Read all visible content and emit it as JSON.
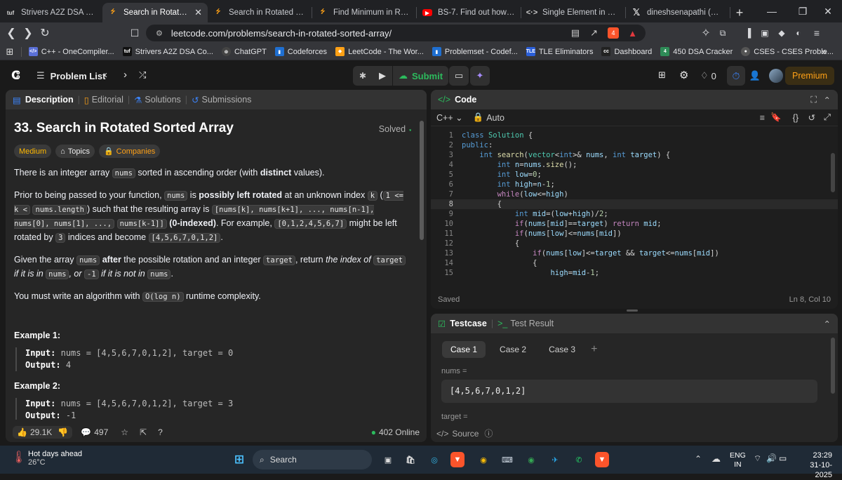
{
  "tabs": [
    {
      "title": "Strivers A2Z DSA Course/S",
      "icon": "tuf-icon",
      "active": false
    },
    {
      "title": "Search in Rotated Sort",
      "icon": "leetcode-icon",
      "active": true
    },
    {
      "title": "Search in Rotated Sorted /",
      "icon": "leetcode-icon",
      "active": false
    },
    {
      "title": "Find Minimum in Rotated",
      "icon": "leetcode-icon",
      "active": false
    },
    {
      "title": "BS-7. Find out how many t",
      "icon": "youtube-icon",
      "active": false
    },
    {
      "title": "Single Element in a Sorted",
      "icon": "web-icon",
      "active": false
    },
    {
      "title": "dineshsenapathi (@dsena",
      "icon": "x-icon",
      "active": false
    }
  ],
  "address": {
    "url": "leetcode.com/problems/search-in-rotated-sorted-array/",
    "brave_badge": "4"
  },
  "bookmarks": [
    {
      "label": "C++ - OneCompiler...",
      "color": "#5a6fd6"
    },
    {
      "label": "Strivers A2Z DSA Co...",
      "color": "#111111"
    },
    {
      "label": "ChatGPT",
      "color": "#444444"
    },
    {
      "label": "Codeforces",
      "color": "#1f6fd1"
    },
    {
      "label": "LeetCode - The Wor...",
      "color": "#ffa116"
    },
    {
      "label": "Problemset - Codef...",
      "color": "#1f6fd1"
    },
    {
      "label": "TLE Eliminators",
      "color": "#2b5fd9"
    },
    {
      "label": "Dashboard",
      "color": "#222222"
    },
    {
      "label": "450 DSA Cracker",
      "color": "#2e8b57"
    },
    {
      "label": "CSES - CSES Proble...",
      "color": "#555555"
    }
  ],
  "lcnav": {
    "problem_list": "Problem List",
    "submit": "Submit",
    "streak": "0",
    "premium": "Premium"
  },
  "desc_tabs": [
    "Description",
    "Editorial",
    "Solutions",
    "Submissions"
  ],
  "problem": {
    "title": "33. Search in Rotated Sorted Array",
    "status": "Solved",
    "difficulty": "Medium",
    "topics": "Topics",
    "companies": "Companies"
  },
  "footer": {
    "likes": "29.1K",
    "comments": "497",
    "online": "402 Online"
  },
  "examples": [
    {
      "title": "Example 1:",
      "input": "nums = [4,5,6,7,0,1,2], target = 0",
      "output": "4"
    },
    {
      "title": "Example 2:",
      "input": "nums = [4,5,6,7,0,1,2], target = 3",
      "output": "-1"
    }
  ],
  "code_panel": {
    "title": "Code",
    "language": "C++",
    "mode": "Auto",
    "saved": "Saved",
    "cursor": "Ln 8, Col 10"
  },
  "testcase": {
    "tab": "Testcase",
    "result_tab": "Test Result",
    "cases": [
      "Case 1",
      "Case 2",
      "Case 3"
    ],
    "nums_label": "nums =",
    "nums_value": "[4,5,6,7,0,1,2]",
    "target_label": "target =",
    "source": "Source"
  },
  "taskbar": {
    "weather_title": "Hot days ahead",
    "temp": "26°C",
    "search": "Search",
    "lang1": "ENG",
    "lang2": "IN",
    "time": "23:29",
    "date": "31-10-2025"
  }
}
